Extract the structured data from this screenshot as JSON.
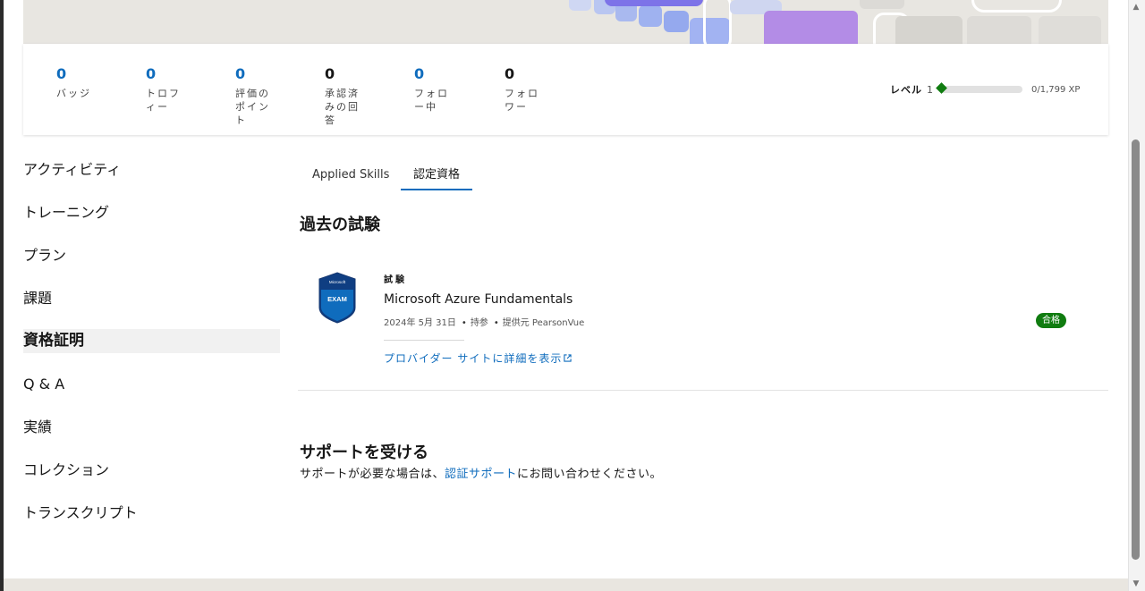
{
  "stats": [
    {
      "value": "0",
      "label": "バッジ",
      "accent": true
    },
    {
      "value": "0",
      "label": "トロフィー",
      "accent": true
    },
    {
      "value": "0",
      "label": "評価のポイント",
      "accent": true
    },
    {
      "value": "0",
      "label": "承認済みの回答",
      "accent": false
    },
    {
      "value": "0",
      "label": "フォロー中",
      "accent": true
    },
    {
      "value": "0",
      "label": "フォロワー",
      "accent": false
    }
  ],
  "level": {
    "label": "レベル",
    "number": "1",
    "xp_text": "0/1,799 XP",
    "progress": 0
  },
  "nav": [
    {
      "label": "アクティビティ"
    },
    {
      "label": "トレーニング"
    },
    {
      "label": "プラン"
    },
    {
      "label": "課題"
    },
    {
      "label": "資格証明",
      "active": true
    },
    {
      "label": "Q & A"
    },
    {
      "label": "実績"
    },
    {
      "label": "コレクション"
    },
    {
      "label": "トランスクリプト"
    }
  ],
  "tabs": [
    {
      "label": "Applied Skills",
      "active": false
    },
    {
      "label": "認定資格",
      "active": true
    }
  ],
  "past_exams": {
    "title": "過去の試験",
    "exam": {
      "badge_top": "Microsoft",
      "badge_text": "EXAM",
      "type": "試験",
      "name": "Microsoft Azure Fundamentals",
      "date": "2024年 5月 31日",
      "ownership": "持参",
      "provider_label": "提供元",
      "provider": "PearsonVue",
      "link": "プロバイダー サイトに詳細を表示",
      "status": "合格"
    }
  },
  "support": {
    "title": "サポートを受ける",
    "text_before": "サポートが必要な場合は、",
    "link": "認証サポート",
    "text_after": "にお問い合わせください。"
  },
  "colors": {
    "accent": "#0f6cbd",
    "success": "#107c10",
    "banner_bg": "#e8e6e1"
  }
}
